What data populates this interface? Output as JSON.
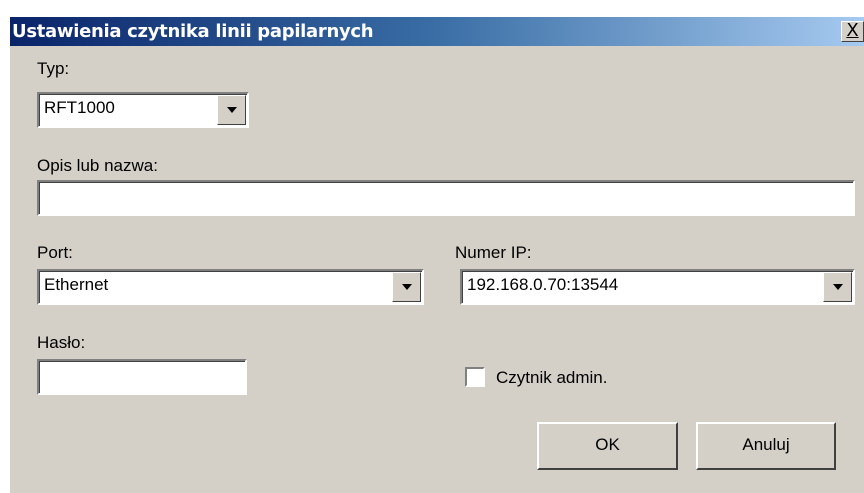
{
  "window": {
    "title": "Ustawienia czytnika linii papilarnych",
    "close_glyph": "X"
  },
  "type": {
    "label": "Typ:",
    "value": "RFT1000"
  },
  "description": {
    "label": "Opis lub nazwa:",
    "value": ""
  },
  "port": {
    "label": "Port:",
    "value": "Ethernet"
  },
  "ip": {
    "label": "Numer IP:",
    "value": "192.168.0.70:13544"
  },
  "password": {
    "label": "Hasło:",
    "value": ""
  },
  "admin_reader": {
    "label": "Czytnik admin.",
    "checked": false
  },
  "buttons": {
    "ok": "OK",
    "cancel": "Anuluj"
  },
  "icons": [
    "close-icon",
    "chevron-down-icon"
  ],
  "colors": {
    "dialog_bg": "#d4d0c8",
    "title_start": "#0a246a",
    "title_end": "#a6caf0"
  }
}
